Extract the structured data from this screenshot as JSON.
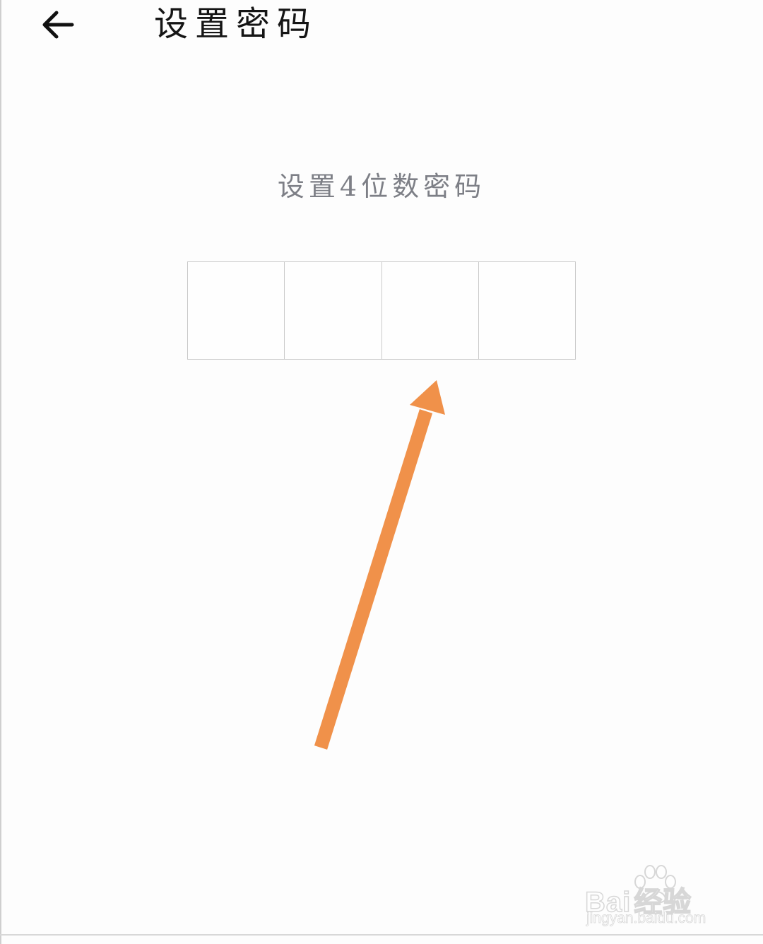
{
  "header": {
    "back_icon": "arrow-left-icon",
    "title": "设置密码"
  },
  "content": {
    "prompt": "设置4位数密码",
    "pin_cells": [
      "",
      "",
      "",
      ""
    ]
  },
  "annotation": {
    "arrow_color": "#f0914a",
    "arrow_icon": "annotation-arrow-icon"
  },
  "watermark": {
    "brand": "Bai",
    "brand_tail": "经验",
    "url": "jingyan.baidu.com",
    "icon": "paw-icon"
  }
}
